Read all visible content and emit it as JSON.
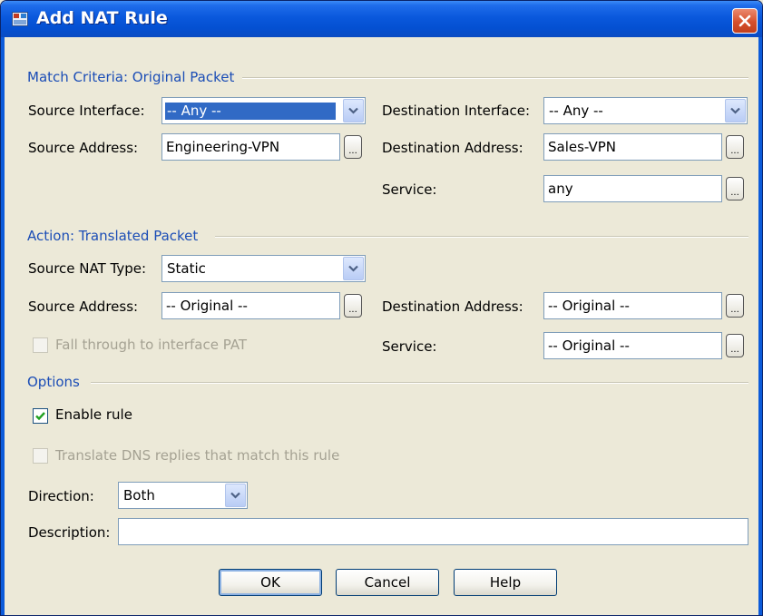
{
  "window": {
    "title": "Add NAT Rule"
  },
  "match": {
    "section_title": "Match Criteria: Original Packet",
    "source_interface_label": "Source Interface:",
    "source_interface_value": "-- Any --",
    "destination_interface_label": "Destination Interface:",
    "destination_interface_value": "-- Any --",
    "source_address_label": "Source Address:",
    "source_address_value": "Engineering-VPN",
    "destination_address_label": "Destination Address:",
    "destination_address_value": "Sales-VPN",
    "service_label": "Service:",
    "service_value": "any"
  },
  "action": {
    "section_title": "Action: Translated Packet",
    "source_nat_type_label": "Source NAT Type:",
    "source_nat_type_value": "Static",
    "source_address_label": "Source Address:",
    "source_address_value": "-- Original --",
    "destination_address_label": "Destination Address:",
    "destination_address_value": "-- Original --",
    "fall_through_label": "Fall through to interface PAT",
    "service_label": "Service:",
    "service_value": "-- Original --"
  },
  "options": {
    "section_title": "Options",
    "enable_rule_label": "Enable rule",
    "enable_rule_checked": true,
    "translate_dns_label": "Translate DNS replies that match this rule",
    "translate_dns_checked": false,
    "direction_label": "Direction:",
    "direction_value": "Both",
    "description_label": "Description:",
    "description_value": ""
  },
  "buttons": {
    "ok": "OK",
    "cancel": "Cancel",
    "help": "Help"
  },
  "browse_label": "...",
  "colors": {
    "title_bar": "#0A58DC",
    "section_text": "#1B4DB6",
    "dialog_bg": "#ECE9D8",
    "close_button": "#D6502D"
  },
  "icons": {
    "title": "nat-rule-app-icon",
    "close": "close-icon",
    "dropdown": "chevron-down-icon",
    "check": "checkmark-icon"
  }
}
